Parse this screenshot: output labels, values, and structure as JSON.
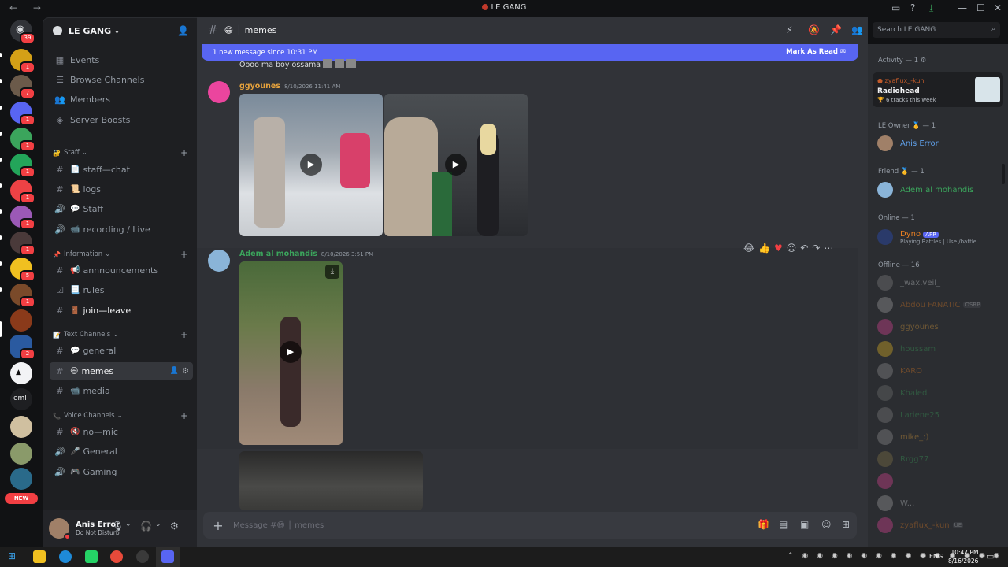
{
  "window": {
    "title": "LE GANG",
    "back": "←",
    "forward": "→"
  },
  "servers": {
    "dm_badge": "39",
    "items": [
      {
        "badge": "1"
      },
      {
        "badge": "7"
      },
      {
        "badge": "1"
      },
      {
        "badge": "1"
      },
      {
        "badge": "1"
      },
      {
        "badge": "1"
      },
      {
        "badge": "1"
      },
      {
        "badge": "1"
      },
      {
        "badge": "5"
      },
      {
        "badge": "1"
      },
      {
        "badge": ""
      },
      {
        "badge": "2"
      },
      {
        "badge": ""
      }
    ],
    "eml_label": "eml",
    "new_label": "NEW"
  },
  "guild": {
    "name": "LE GANG",
    "top_items": [
      "Events",
      "Browse Channels",
      "Members",
      "Server Boosts"
    ],
    "categories": {
      "staff": "Staff",
      "information": "Information",
      "text": "Text Channels",
      "voice": "Voice Channels"
    },
    "channels": {
      "staff_chat": "staff—chat",
      "logs": "logs",
      "staff": "Staff",
      "recording": "recording / Live",
      "announcements": "annnouncements",
      "rules": "rules",
      "join_leave": "join—leave",
      "general": "general",
      "memes": "memes",
      "media": "media",
      "no_mic": "no—mic",
      "voice_general": "General",
      "gaming": "Gaming"
    }
  },
  "user": {
    "name": "Anis Error",
    "status": "Do Not Disturb"
  },
  "chat": {
    "channel_emoji": "😄",
    "channel_name": "memes",
    "search_placeholder": "Search LE GANG",
    "new_message_bar": "1 new message since 10:31 PM",
    "mark_as_read": "Mark As Read",
    "prev_message_text": "Oooo ma boy ossama",
    "messages": [
      {
        "author": "ggyounes",
        "timestamp": "8/10/2026 11:41 AM",
        "color": "#e6a23c"
      },
      {
        "author": "Adem al mohandis",
        "timestamp": "8/10/2026 3:51 PM",
        "color": "#3ba55c"
      }
    ],
    "composer_placeholder": "Message #😄 │ memes"
  },
  "members": {
    "activity_header": "Activity — 1",
    "activity": {
      "user": "zyaflux_-kun",
      "title": "Radiohead",
      "detail": "6 tracks this week"
    },
    "owner_header": "LE Owner 🥇 — 1",
    "owner": "Anis Error",
    "friend_header": "Friend 🥇 — 1",
    "friend": "Adem al mohandis",
    "online_header": "Online — 1",
    "dyno": {
      "name": "Dyno",
      "tag": "APP",
      "status": "Playing Battles | Use /battle"
    },
    "offline_header": "Offline — 16",
    "offline": [
      "_wax.veil_",
      "Abdou FANATIC",
      "ggyounes",
      "houssam",
      "KARO",
      "Khaled",
      "Lariene25",
      "mike_:)",
      "Rrgg77",
      "",
      "W...",
      "zyaflux_-kun"
    ],
    "tags": {
      "abdou": "OSRP",
      "zyaflux": "UE"
    }
  },
  "taskbar": {
    "time": "10:47 PM",
    "date": "8/16/2026",
    "lang": "ENG"
  }
}
